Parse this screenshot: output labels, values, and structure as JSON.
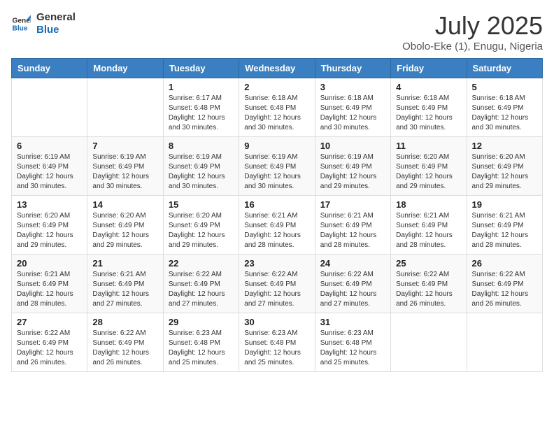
{
  "logo": {
    "line1": "General",
    "line2": "Blue"
  },
  "title": "July 2025",
  "location": "Obolo-Eke (1), Enugu, Nigeria",
  "days_of_week": [
    "Sunday",
    "Monday",
    "Tuesday",
    "Wednesday",
    "Thursday",
    "Friday",
    "Saturday"
  ],
  "weeks": [
    [
      {
        "day": "",
        "info": ""
      },
      {
        "day": "",
        "info": ""
      },
      {
        "day": "1",
        "info": "Sunrise: 6:17 AM\nSunset: 6:48 PM\nDaylight: 12 hours and 30 minutes."
      },
      {
        "day": "2",
        "info": "Sunrise: 6:18 AM\nSunset: 6:48 PM\nDaylight: 12 hours and 30 minutes."
      },
      {
        "day": "3",
        "info": "Sunrise: 6:18 AM\nSunset: 6:49 PM\nDaylight: 12 hours and 30 minutes."
      },
      {
        "day": "4",
        "info": "Sunrise: 6:18 AM\nSunset: 6:49 PM\nDaylight: 12 hours and 30 minutes."
      },
      {
        "day": "5",
        "info": "Sunrise: 6:18 AM\nSunset: 6:49 PM\nDaylight: 12 hours and 30 minutes."
      }
    ],
    [
      {
        "day": "6",
        "info": "Sunrise: 6:19 AM\nSunset: 6:49 PM\nDaylight: 12 hours and 30 minutes."
      },
      {
        "day": "7",
        "info": "Sunrise: 6:19 AM\nSunset: 6:49 PM\nDaylight: 12 hours and 30 minutes."
      },
      {
        "day": "8",
        "info": "Sunrise: 6:19 AM\nSunset: 6:49 PM\nDaylight: 12 hours and 30 minutes."
      },
      {
        "day": "9",
        "info": "Sunrise: 6:19 AM\nSunset: 6:49 PM\nDaylight: 12 hours and 30 minutes."
      },
      {
        "day": "10",
        "info": "Sunrise: 6:19 AM\nSunset: 6:49 PM\nDaylight: 12 hours and 29 minutes."
      },
      {
        "day": "11",
        "info": "Sunrise: 6:20 AM\nSunset: 6:49 PM\nDaylight: 12 hours and 29 minutes."
      },
      {
        "day": "12",
        "info": "Sunrise: 6:20 AM\nSunset: 6:49 PM\nDaylight: 12 hours and 29 minutes."
      }
    ],
    [
      {
        "day": "13",
        "info": "Sunrise: 6:20 AM\nSunset: 6:49 PM\nDaylight: 12 hours and 29 minutes."
      },
      {
        "day": "14",
        "info": "Sunrise: 6:20 AM\nSunset: 6:49 PM\nDaylight: 12 hours and 29 minutes."
      },
      {
        "day": "15",
        "info": "Sunrise: 6:20 AM\nSunset: 6:49 PM\nDaylight: 12 hours and 29 minutes."
      },
      {
        "day": "16",
        "info": "Sunrise: 6:21 AM\nSunset: 6:49 PM\nDaylight: 12 hours and 28 minutes."
      },
      {
        "day": "17",
        "info": "Sunrise: 6:21 AM\nSunset: 6:49 PM\nDaylight: 12 hours and 28 minutes."
      },
      {
        "day": "18",
        "info": "Sunrise: 6:21 AM\nSunset: 6:49 PM\nDaylight: 12 hours and 28 minutes."
      },
      {
        "day": "19",
        "info": "Sunrise: 6:21 AM\nSunset: 6:49 PM\nDaylight: 12 hours and 28 minutes."
      }
    ],
    [
      {
        "day": "20",
        "info": "Sunrise: 6:21 AM\nSunset: 6:49 PM\nDaylight: 12 hours and 28 minutes."
      },
      {
        "day": "21",
        "info": "Sunrise: 6:21 AM\nSunset: 6:49 PM\nDaylight: 12 hours and 27 minutes."
      },
      {
        "day": "22",
        "info": "Sunrise: 6:22 AM\nSunset: 6:49 PM\nDaylight: 12 hours and 27 minutes."
      },
      {
        "day": "23",
        "info": "Sunrise: 6:22 AM\nSunset: 6:49 PM\nDaylight: 12 hours and 27 minutes."
      },
      {
        "day": "24",
        "info": "Sunrise: 6:22 AM\nSunset: 6:49 PM\nDaylight: 12 hours and 27 minutes."
      },
      {
        "day": "25",
        "info": "Sunrise: 6:22 AM\nSunset: 6:49 PM\nDaylight: 12 hours and 26 minutes."
      },
      {
        "day": "26",
        "info": "Sunrise: 6:22 AM\nSunset: 6:49 PM\nDaylight: 12 hours and 26 minutes."
      }
    ],
    [
      {
        "day": "27",
        "info": "Sunrise: 6:22 AM\nSunset: 6:49 PM\nDaylight: 12 hours and 26 minutes."
      },
      {
        "day": "28",
        "info": "Sunrise: 6:22 AM\nSunset: 6:49 PM\nDaylight: 12 hours and 26 minutes."
      },
      {
        "day": "29",
        "info": "Sunrise: 6:23 AM\nSunset: 6:48 PM\nDaylight: 12 hours and 25 minutes."
      },
      {
        "day": "30",
        "info": "Sunrise: 6:23 AM\nSunset: 6:48 PM\nDaylight: 12 hours and 25 minutes."
      },
      {
        "day": "31",
        "info": "Sunrise: 6:23 AM\nSunset: 6:48 PM\nDaylight: 12 hours and 25 minutes."
      },
      {
        "day": "",
        "info": ""
      },
      {
        "day": "",
        "info": ""
      }
    ]
  ]
}
